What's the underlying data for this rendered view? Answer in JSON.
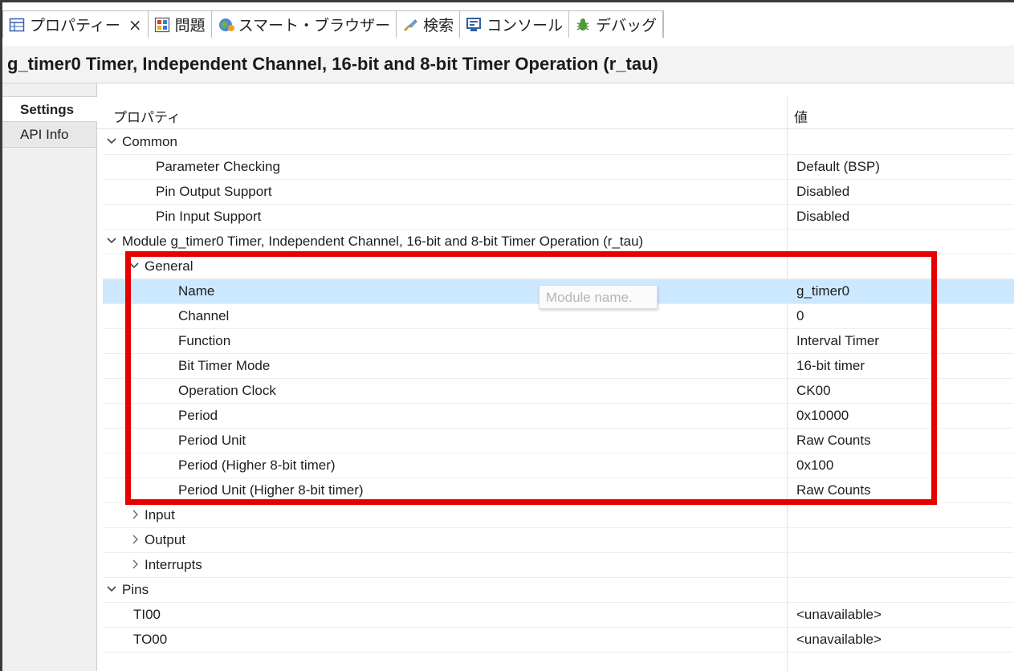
{
  "tabs": [
    {
      "label": "プロパティー",
      "icon": "properties-icon",
      "close": "×"
    },
    {
      "label": "問題",
      "icon": "problems-icon"
    },
    {
      "label": "スマート・ブラウザー",
      "icon": "smart-browser-icon"
    },
    {
      "label": "検索",
      "icon": "search-icon"
    },
    {
      "label": "コンソール",
      "icon": "console-icon"
    },
    {
      "label": "デバッグ",
      "icon": "debug-icon"
    }
  ],
  "title": "g_timer0 Timer, Independent Channel, 16-bit and 8-bit Timer Operation (r_tau)",
  "side_tabs": {
    "settings": "Settings",
    "api_info": "API Info"
  },
  "columns": {
    "property": "プロパティ",
    "value": "値"
  },
  "rows": [
    {
      "label": "Common",
      "value": ""
    },
    {
      "label": "Parameter Checking",
      "value": "Default (BSP)"
    },
    {
      "label": "Pin Output Support",
      "value": "Disabled"
    },
    {
      "label": "Pin Input Support",
      "value": "Disabled"
    },
    {
      "label": "Module g_timer0 Timer, Independent Channel, 16-bit and 8-bit Timer Operation (r_tau)",
      "value": ""
    },
    {
      "label": "General",
      "value": ""
    },
    {
      "label": "Name",
      "value": "g_timer0"
    },
    {
      "label": "Channel",
      "value": "0"
    },
    {
      "label": "Function",
      "value": "Interval Timer"
    },
    {
      "label": "Bit Timer Mode",
      "value": "16-bit timer"
    },
    {
      "label": "Operation Clock",
      "value": "CK00"
    },
    {
      "label": "Period",
      "value": "0x10000"
    },
    {
      "label": "Period Unit",
      "value": "Raw Counts"
    },
    {
      "label": "Period (Higher 8-bit timer)",
      "value": "0x100"
    },
    {
      "label": "Period Unit (Higher 8-bit timer)",
      "value": "Raw Counts"
    },
    {
      "label": "Input",
      "value": ""
    },
    {
      "label": "Output",
      "value": ""
    },
    {
      "label": "Interrupts",
      "value": ""
    },
    {
      "label": "Pins",
      "value": ""
    },
    {
      "label": "TI00",
      "value": "<unavailable>"
    },
    {
      "label": "TO00",
      "value": "<unavailable>"
    }
  ],
  "tooltip": "Module name.",
  "colors": {
    "selection": "#cce8ff",
    "highlight_box": "#e60000"
  }
}
